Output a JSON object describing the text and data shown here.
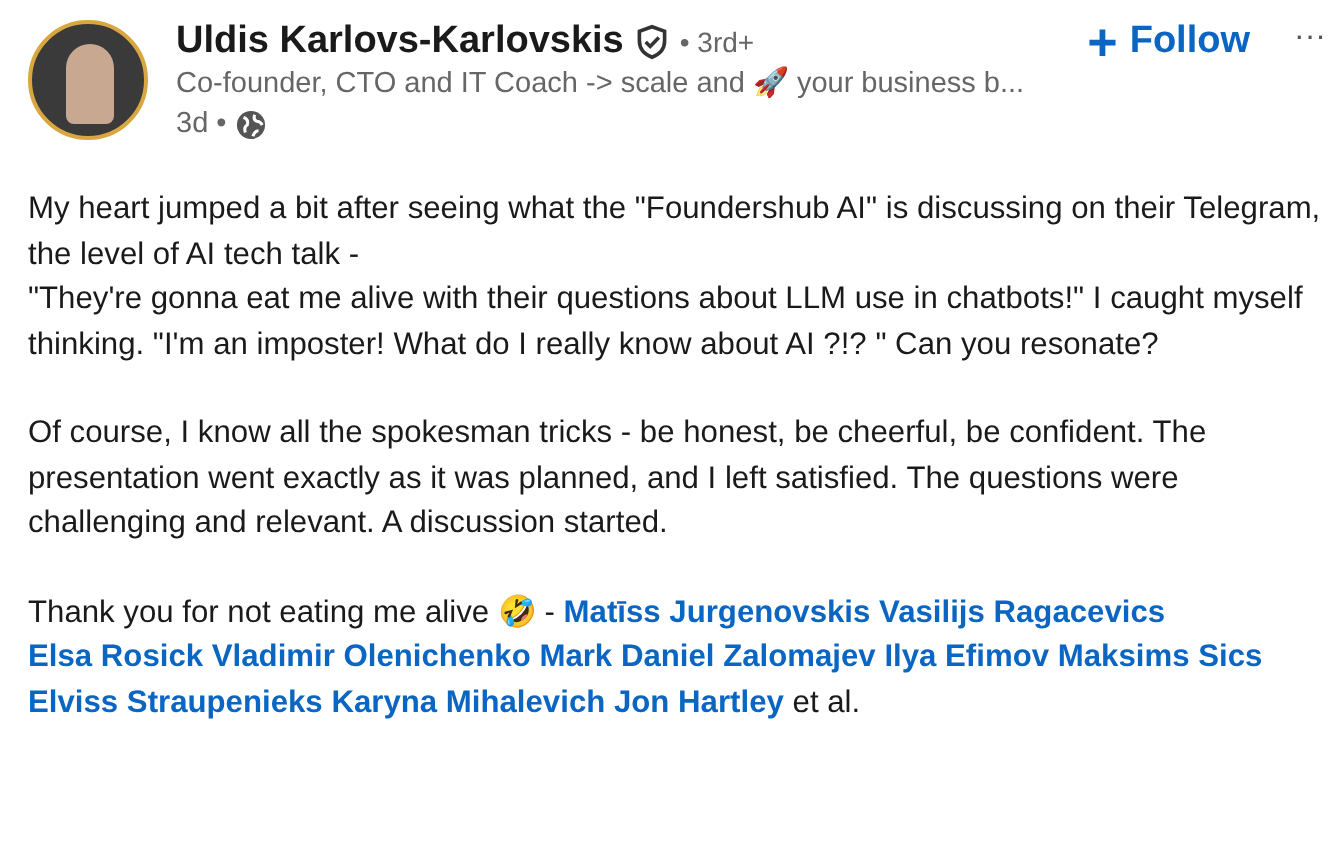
{
  "author": {
    "name": "Uldis Karlovs-Karlovskis",
    "degree": "• 3rd+",
    "headline": "Co-founder, CTO and IT Coach -> scale and 🚀 your business b...",
    "time": "3d •"
  },
  "follow_button": {
    "icon": "+",
    "label": "Follow"
  },
  "more_button": {
    "label": "···"
  },
  "paragraphs": [
    "My heart jumped a bit after seeing what the \"Foundershub AI\" is discussing on their Telegram, the level of AI tech talk -\n\"They're gonna eat me alive with their questions about LLM use in chatbots!\" I caught myself thinking. \"I'm an imposter! What do I really know about AI ?!? \" Can you resonate?",
    "Of course, I know all the spokesman tricks - be honest, be cheerful, be confident. The presentation went exactly as it was planned, and I left satisfied. The questions were challenging and relevant. A discussion started."
  ],
  "closing": {
    "text": "Thank you for not eating me alive 🤣  -",
    "mentions": [
      "Matīss Jurgenovskis",
      "Vasilijs Ragacevics",
      "Elsa Rosick",
      "Vladimir Olenichenko",
      "Mark Daniel Zalomajev",
      "Ilya Efimov",
      "Maksims Sics",
      "Elviss Straupenieks",
      "Karyna Mihalevich",
      "Jon Hartley"
    ],
    "suffix": "et al."
  }
}
